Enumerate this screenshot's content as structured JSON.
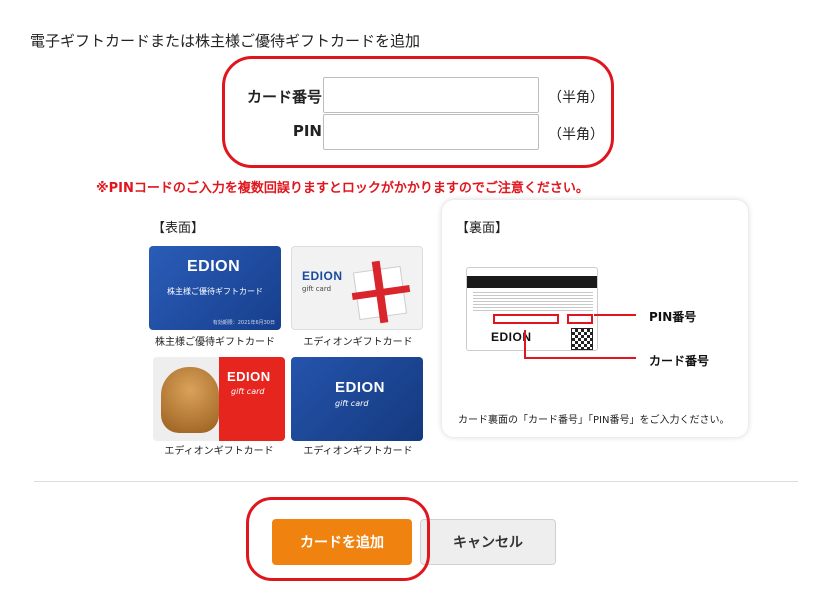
{
  "heading": "電子ギフトカードまたは株主様ご優待ギフトカードを追加",
  "form": {
    "card_number_label": "カード番号",
    "card_number_value": "",
    "card_number_note": "（半角）",
    "pin_label": "PIN",
    "pin_value": "",
    "pin_note": "（半角）"
  },
  "warning": "※PINコードのご入力を複数回誤りますとロックがかかりますのでご注意ください。",
  "front": {
    "label": "【表面】",
    "cards": [
      {
        "logo": "EDION",
        "subtitle": "株主様ご優待ギフトカード",
        "date": "有効期限：2021年6月30日",
        "caption": "株主様ご優待ギフトカード"
      },
      {
        "logo": "EDION",
        "subtitle": "gift card",
        "caption": "エディオンギフトカード"
      },
      {
        "logo": "EDION",
        "subtitle": "gift card",
        "caption": "エディオンギフトカード"
      },
      {
        "logo": "EDION",
        "subtitle": "gift card",
        "caption": "エディオンギフトカード"
      }
    ]
  },
  "back": {
    "label": "【裏面】",
    "logo": "EDION",
    "pin_tag": "PIN番号",
    "card_tag": "カード番号",
    "note": "カード裏面の「カード番号」「PIN番号」をご入力ください。"
  },
  "buttons": {
    "add": "カードを追加",
    "cancel": "キャンセル"
  },
  "colors": {
    "accent_orange": "#f0820f",
    "warning_red": "#e0161e",
    "card_blue": "#2a5db8"
  }
}
